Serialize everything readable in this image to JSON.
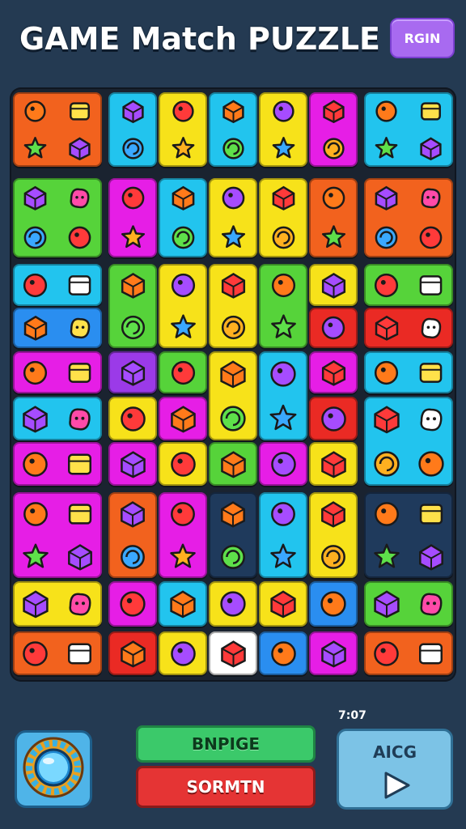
{
  "header": {
    "title": "GAME Match PUZZLE",
    "login_label": "RGIN"
  },
  "colors": {
    "background": "#243a52",
    "board": "#1a2330",
    "orange": "#f2621e",
    "cyan": "#22c4ee",
    "yellow": "#f7e21a",
    "magenta": "#e61ee6",
    "green": "#56d33a",
    "blue": "#2a8ef0",
    "red": "#ea2a24",
    "purple": "#9b3ae8",
    "navy": "#1f3a5c"
  },
  "board": {
    "icons": [
      "bird-icon",
      "brush-icon",
      "fish-icon",
      "leaf-icon",
      "lightbulb-icon",
      "box-icon",
      "star-icon",
      "star-icon",
      "crown-icon",
      "hook-icon",
      "ring-icon",
      "star-icon",
      "fruit-icon",
      "block-icon",
      "book-icon",
      "pouch-icon",
      "hat-icon",
      "cup-icon",
      "blob-icon",
      "face-icon",
      "splat-icon",
      "window-icon",
      "star-icon",
      "box-icon",
      "cookie-icon",
      "cat-icon",
      "brush-icon",
      "eraser-icon",
      "ball-icon",
      "pencil-icon",
      "lines-icon",
      "gear-icon",
      "tag-icon",
      "gem-icon",
      "swirl-icon",
      "disc-icon",
      "book-icon",
      "crystal-icon",
      "cube-icon",
      "star-icon",
      "gem-icon",
      "splat-icon",
      "rocket-icon",
      "cheese-icon",
      "cube-icon",
      "paper-icon",
      "box-icon",
      "bag-icon",
      "plant-icon",
      "plant-icon",
      "coin-icon",
      "swirl-icon",
      "tools-icon",
      "page-icon",
      "flower-icon",
      "lamp-icon",
      "cheese-icon",
      "dice-icon",
      "music-icon",
      "envelope-icon",
      "face-icon",
      "cube-icon",
      "gear-icon",
      "splat-icon",
      "box-icon",
      "calc-icon",
      "pencil-icon",
      "ticket-icon",
      "leaf-icon",
      "cube-icon",
      "pillow-icon",
      "face-icon",
      "flower-icon",
      "flag-icon",
      "apple-icon",
      "blob-icon",
      "eye-icon",
      "fox-icon",
      "heart-icon",
      "bomb-icon",
      "pin-icon",
      "stamp-icon",
      "box-icon",
      "tool-icon",
      "cube-icon",
      "cat-icon",
      "spiral-icon",
      "face-icon",
      "flashlight-icon",
      "bomb-icon",
      "disc-icon",
      "flag-icon",
      "apple-icon",
      "cake-icon",
      "diamond-icon",
      "leaf-icon",
      "face-icon",
      "star-icon",
      "monster-icon",
      "grape-icon",
      "cheese-icon"
    ]
  },
  "controls": {
    "shuffle_icon": "compass-icon",
    "green_button_label": "BNPIGE",
    "red_button_label": "SORMTN",
    "timer_text": "7:07",
    "play_button_label": "AICG",
    "play_icon": "play-icon"
  }
}
